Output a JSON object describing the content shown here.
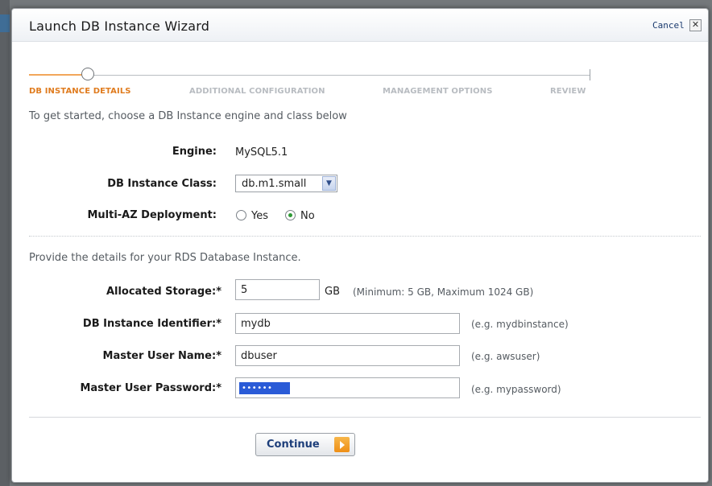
{
  "dialog": {
    "title": "Launch DB Instance Wizard",
    "cancel_label": "Cancel",
    "close_glyph": "✕"
  },
  "steps": [
    {
      "label": "DB INSTANCE DETAILS",
      "active": true
    },
    {
      "label": "ADDITIONAL CONFIGURATION",
      "active": false
    },
    {
      "label": "MANAGEMENT OPTIONS",
      "active": false
    },
    {
      "label": "REVIEW",
      "active": false
    }
  ],
  "intro_text": "To get started, choose a DB Instance engine and class below",
  "engine": {
    "label": "Engine:",
    "value": "MySQL5.1"
  },
  "instance_class": {
    "label": "DB Instance Class:",
    "value": "db.m1.small"
  },
  "multi_az": {
    "label": "Multi-AZ Deployment:",
    "yes_label": "Yes",
    "no_label": "No",
    "selected": "No"
  },
  "details_text": "Provide the details for your RDS Database Instance.",
  "storage": {
    "label": "Allocated Storage:*",
    "value": "5",
    "unit": "GB",
    "hint": "(Minimum: 5 GB, Maximum 1024 GB)"
  },
  "identifier": {
    "label": "DB Instance Identifier:*",
    "value": "mydb",
    "hint": "(e.g. mydbinstance)"
  },
  "master_user": {
    "label": "Master User Name:*",
    "value": "dbuser",
    "hint": "(e.g. awsuser)"
  },
  "master_password": {
    "label": "Master User Password:*",
    "value": "••••••",
    "hint": "(e.g. mypassword)"
  },
  "continue_label": "Continue",
  "colors": {
    "accent": "#e07c1f",
    "link": "#1d3e7a",
    "radio_selected": "#2f9a36"
  }
}
